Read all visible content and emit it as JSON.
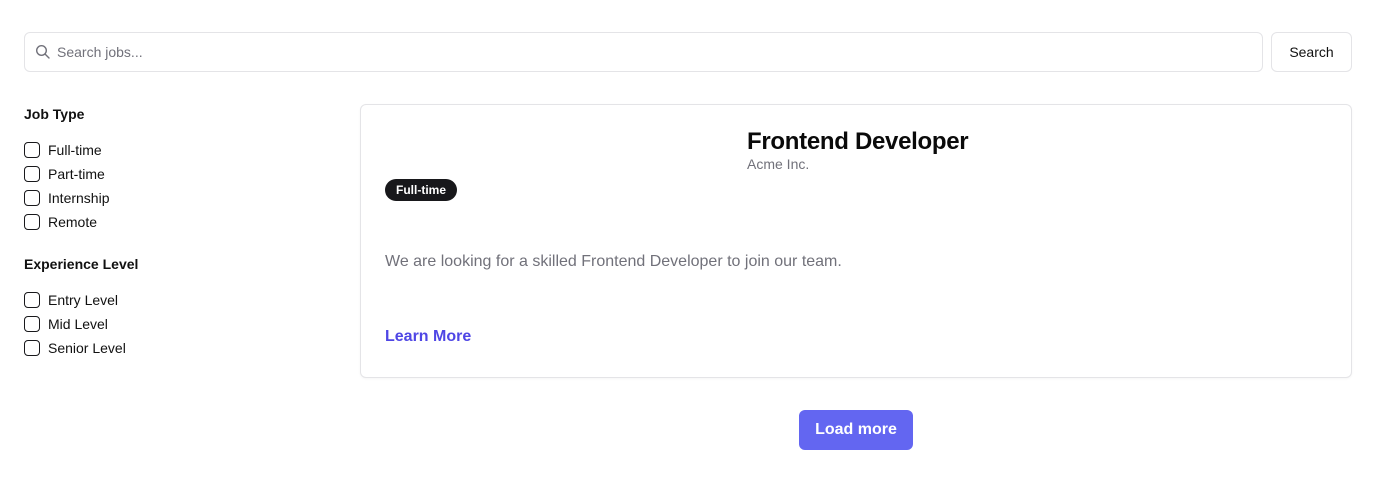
{
  "search": {
    "placeholder": "Search jobs...",
    "value": "",
    "button_label": "Search"
  },
  "filters": {
    "job_type": {
      "heading": "Job Type",
      "options": [
        {
          "label": "Full-time",
          "checked": false
        },
        {
          "label": "Part-time",
          "checked": false
        },
        {
          "label": "Internship",
          "checked": false
        },
        {
          "label": "Remote",
          "checked": false
        }
      ]
    },
    "experience_level": {
      "heading": "Experience Level",
      "options": [
        {
          "label": "Entry Level",
          "checked": false
        },
        {
          "label": "Mid Level",
          "checked": false
        },
        {
          "label": "Senior Level",
          "checked": false
        }
      ]
    }
  },
  "jobs": [
    {
      "title": "Frontend Developer",
      "company": "Acme Inc.",
      "badge": "Full-time",
      "description": "We are looking for a skilled Frontend Developer to join our team.",
      "link_label": "Learn More"
    }
  ],
  "load_more_label": "Load more",
  "colors": {
    "accent": "#6366f1",
    "link": "#4f46e5",
    "badge_bg": "#18181b",
    "muted_text": "#71717a",
    "border": "#e4e4e7"
  }
}
